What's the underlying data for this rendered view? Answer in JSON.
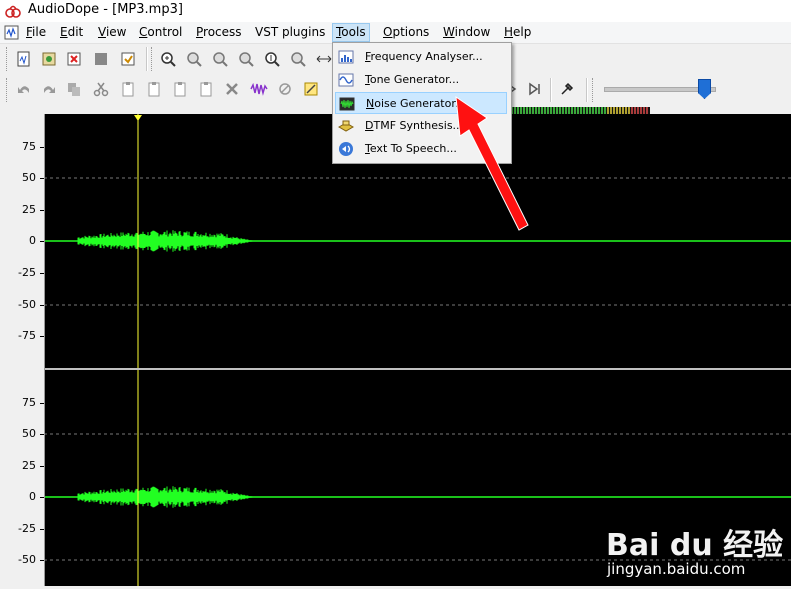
{
  "window": {
    "title": "AudioDope - [MP3.mp3]"
  },
  "menubar": {
    "items": [
      {
        "label": "File",
        "key": "F"
      },
      {
        "label": "Edit",
        "key": "E"
      },
      {
        "label": "View",
        "key": "V"
      },
      {
        "label": "Control",
        "key": "C"
      },
      {
        "label": "Process",
        "key": "P"
      },
      {
        "label": "VST plugins",
        "key": ""
      },
      {
        "label": "Tools",
        "key": "T"
      },
      {
        "label": "Options",
        "key": "O"
      },
      {
        "label": "Window",
        "key": "W"
      },
      {
        "label": "Help",
        "key": "H"
      }
    ],
    "active": "Tools"
  },
  "tools_menu": {
    "items": [
      {
        "label": "Frequency Analyser...",
        "accel": "F",
        "icon": "frequency-analyser-icon"
      },
      {
        "label": "Tone Generator...",
        "accel": "T",
        "icon": "tone-generator-icon"
      },
      {
        "label": "Noise Generator...",
        "accel": "N",
        "icon": "noise-generator-icon"
      },
      {
        "label": "DTMF Synthesis...",
        "accel": "D",
        "icon": "dtmf-synthesis-icon"
      },
      {
        "label": "Text To Speech...",
        "accel": "T",
        "icon": "text-to-speech-icon"
      }
    ],
    "highlighted": "Noise Generator..."
  },
  "ruler": {
    "labels": [
      "75",
      "50",
      "25",
      "0",
      "-25",
      "-50",
      "-75",
      "75",
      "50",
      "25",
      "0",
      "-25",
      "-50"
    ]
  },
  "watermark": {
    "brand": "Bai du 经验",
    "url": "jingyan.baidu.com"
  },
  "colors": {
    "waveform": "#22ff22",
    "cursor": "#ffff33",
    "background": "#000000",
    "highlight": "#cce8ff",
    "arrow": "#ff1111"
  }
}
